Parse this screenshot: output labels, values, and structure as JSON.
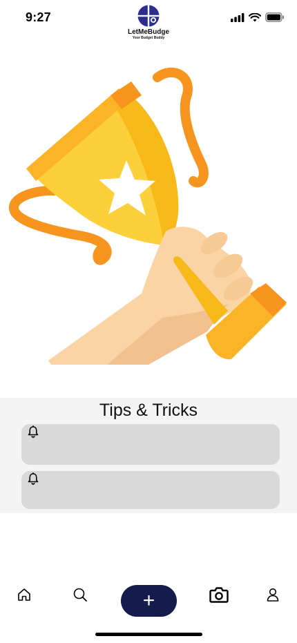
{
  "status_bar": {
    "time": "9:27",
    "icons": [
      "signal-icon",
      "wifi-icon",
      "battery-icon"
    ]
  },
  "app": {
    "name": "LetMeBudge",
    "tagline": "Your Budget Buddy",
    "brand_color": "#2b2e8f"
  },
  "hero": {
    "illustration": "trophy-in-hand-illustration"
  },
  "tips": {
    "title": "Tips & Tricks",
    "cards": [
      {
        "icon": "bell-icon",
        "text": ""
      },
      {
        "icon": "bell-icon",
        "text": ""
      }
    ]
  },
  "tabbar": {
    "items": [
      "home-icon",
      "search-icon",
      "add-button",
      "camera-icon",
      "profile-icon"
    ],
    "add_label": "+",
    "accent_color": "#161b4d"
  }
}
